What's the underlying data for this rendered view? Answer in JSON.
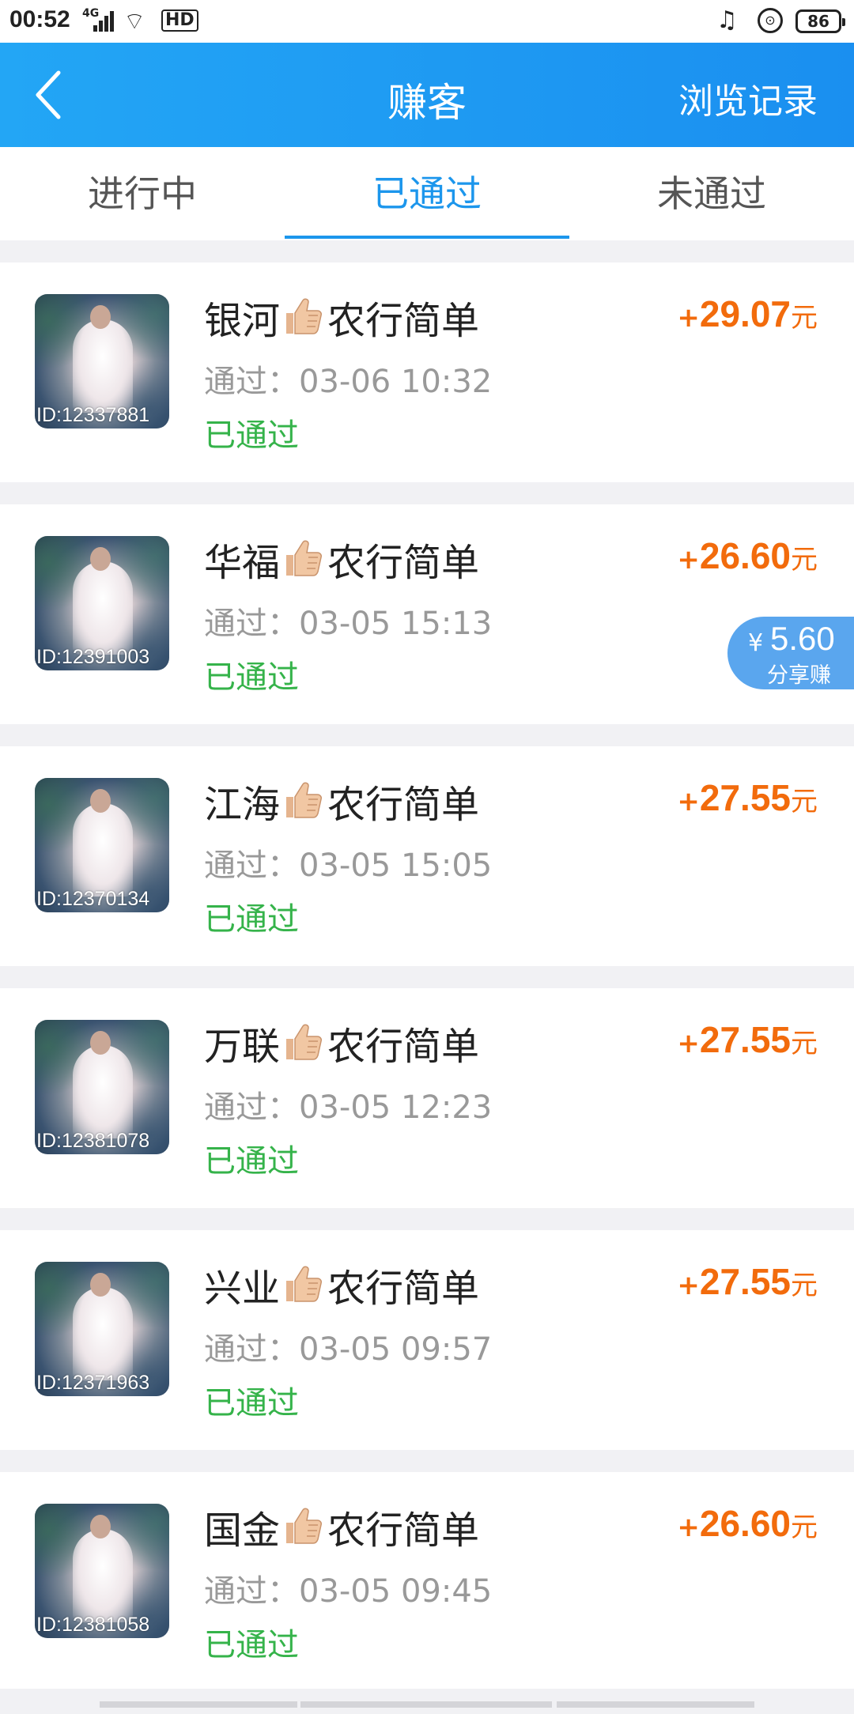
{
  "status_bar": {
    "time": "00:52",
    "signal_label": "4G",
    "hd_label": "HD",
    "battery": "86"
  },
  "nav": {
    "title": "赚客",
    "history_label": "浏览记录"
  },
  "tabs": [
    {
      "label": "进行中",
      "active": false
    },
    {
      "label": "已通过",
      "active": true
    },
    {
      "label": "未通过",
      "active": false
    }
  ],
  "items": [
    {
      "id": "ID:12337881",
      "name_prefix": "银河",
      "name_suffix": "农行简单",
      "time_label": "通过：",
      "time": "03-06 10:32",
      "status": "已通过",
      "amount_sign": "+",
      "amount": "29.07",
      "unit": "元"
    },
    {
      "id": "ID:12391003",
      "name_prefix": "华福",
      "name_suffix": "农行简单",
      "time_label": "通过：",
      "time": "03-05 15:13",
      "status": "已通过",
      "amount_sign": "+",
      "amount": "26.60",
      "unit": "元",
      "share": {
        "currency": "¥",
        "value": "5.60",
        "label": "分享赚"
      }
    },
    {
      "id": "ID:12370134",
      "name_prefix": "江海",
      "name_suffix": "农行简单",
      "time_label": "通过：",
      "time": "03-05 15:05",
      "status": "已通过",
      "amount_sign": "+",
      "amount": "27.55",
      "unit": "元"
    },
    {
      "id": "ID:12381078",
      "name_prefix": "万联",
      "name_suffix": "农行简单",
      "time_label": "通过：",
      "time": "03-05 12:23",
      "status": "已通过",
      "amount_sign": "+",
      "amount": "27.55",
      "unit": "元"
    },
    {
      "id": "ID:12371963",
      "name_prefix": "兴业",
      "name_suffix": "农行简单",
      "time_label": "通过：",
      "time": "03-05 09:57",
      "status": "已通过",
      "amount_sign": "+",
      "amount": "27.55",
      "unit": "元"
    },
    {
      "id": "ID:12381058",
      "name_prefix": "国金",
      "name_suffix": "农行简单",
      "time_label": "通过：",
      "time": "03-05 09:45",
      "status": "已通过",
      "amount_sign": "+",
      "amount": "26.60",
      "unit": "元"
    }
  ],
  "colors": {
    "nav_blue": "#1c96ec",
    "amount_orange": "#f26b0c",
    "status_green": "#35b34a",
    "share_badge": "#5aa6ee"
  }
}
